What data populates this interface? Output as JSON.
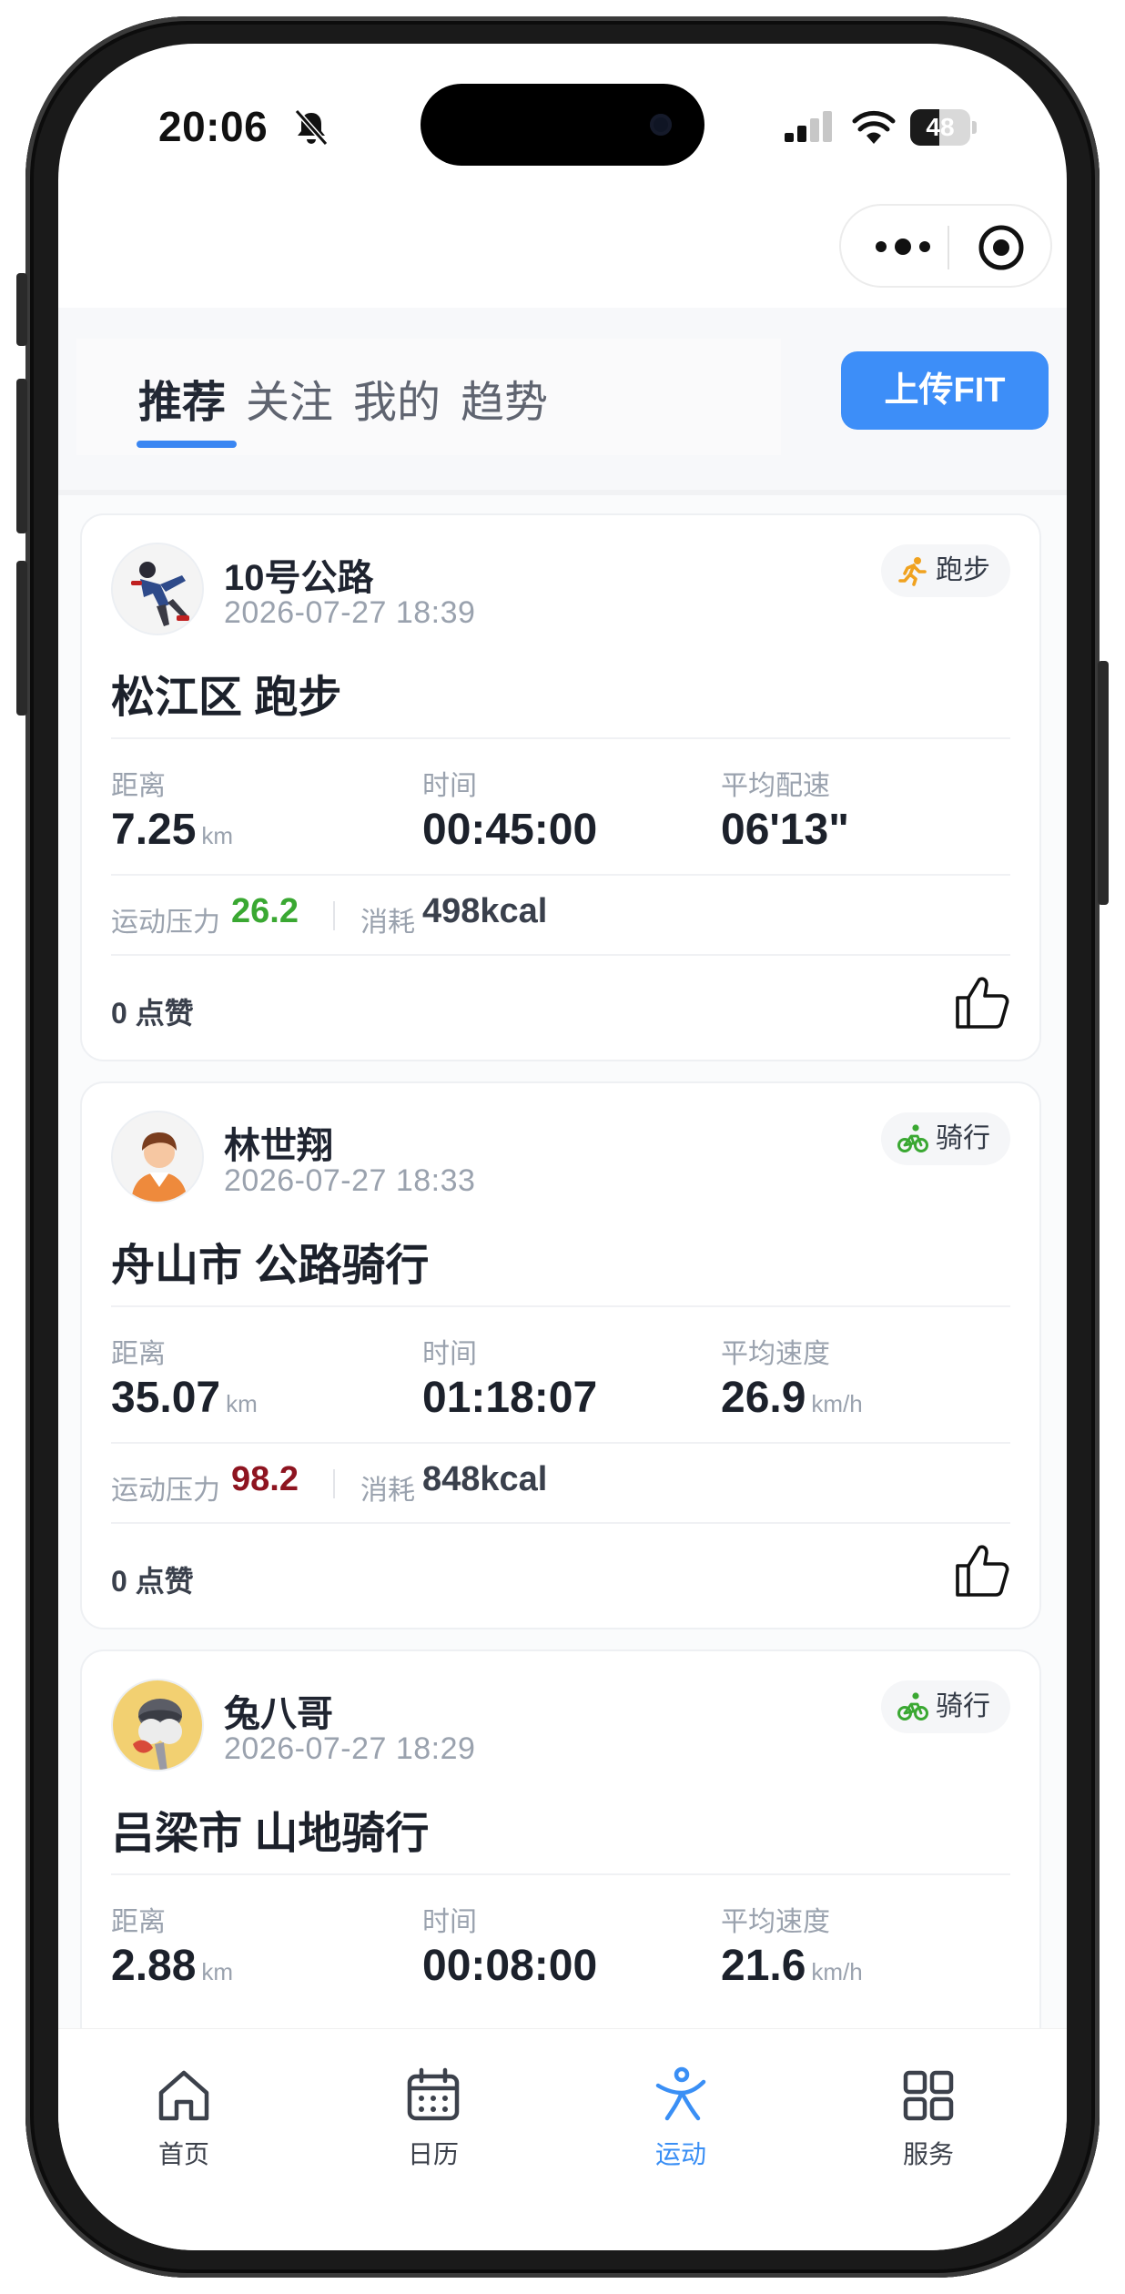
{
  "status": {
    "time": "20:06",
    "battery": "48",
    "battery_level": 0.48
  },
  "tabs": [
    {
      "label": "推荐",
      "active": true
    },
    {
      "label": "关注",
      "active": false
    },
    {
      "label": "我的",
      "active": false
    },
    {
      "label": "趋势",
      "active": false
    }
  ],
  "upload_label": "上传FIT",
  "posts": [
    {
      "user": "10号公路",
      "datetime": "2026-07-27 18:39",
      "sport_badge": "跑步",
      "badge_icon": "running-icon",
      "badge_color": "#f0a21f",
      "title": "松江区 跑步",
      "stats": [
        {
          "label": "距离",
          "value": "7.25",
          "unit": "km"
        },
        {
          "label": "时间",
          "value": "00:45:00",
          "unit": ""
        },
        {
          "label": "平均配速",
          "value": "06'13\"",
          "unit": ""
        }
      ],
      "stress_label": "运动压力",
      "stress_value": "26.2",
      "stress_color": "#3aa832",
      "calorie_label": "消耗",
      "calorie_value": "498kcal",
      "likes": "0 点赞"
    },
    {
      "user": "林世翔",
      "datetime": "2026-07-27 18:33",
      "sport_badge": "骑行",
      "badge_icon": "cycling-icon",
      "badge_color": "#3aa832",
      "title": "舟山市 公路骑行",
      "stats": [
        {
          "label": "距离",
          "value": "35.07",
          "unit": "km"
        },
        {
          "label": "时间",
          "value": "01:18:07",
          "unit": ""
        },
        {
          "label": "平均速度",
          "value": "26.9",
          "unit": "km/h"
        }
      ],
      "stress_label": "运动压力",
      "stress_value": "98.2",
      "stress_color": "#8e1420",
      "calorie_label": "消耗",
      "calorie_value": "848kcal",
      "likes": "0 点赞"
    },
    {
      "user": "兔八哥",
      "datetime": "2026-07-27 18:29",
      "sport_badge": "骑行",
      "badge_icon": "cycling-icon",
      "badge_color": "#3aa832",
      "title": "吕梁市 山地骑行",
      "stats": [
        {
          "label": "距离",
          "value": "2.88",
          "unit": "km"
        },
        {
          "label": "时间",
          "value": "00:08:00",
          "unit": ""
        },
        {
          "label": "平均速度",
          "value": "21.6",
          "unit": "km/h"
        }
      ]
    }
  ],
  "nav": [
    {
      "label": "首页",
      "icon": "home-icon",
      "active": false
    },
    {
      "label": "日历",
      "icon": "calendar-icon",
      "active": false
    },
    {
      "label": "运动",
      "icon": "sport-icon",
      "active": true
    },
    {
      "label": "服务",
      "icon": "grid-icon",
      "active": false
    }
  ],
  "colors": {
    "accent": "#3d8ef8",
    "nav_active": "#3a8ff5"
  }
}
